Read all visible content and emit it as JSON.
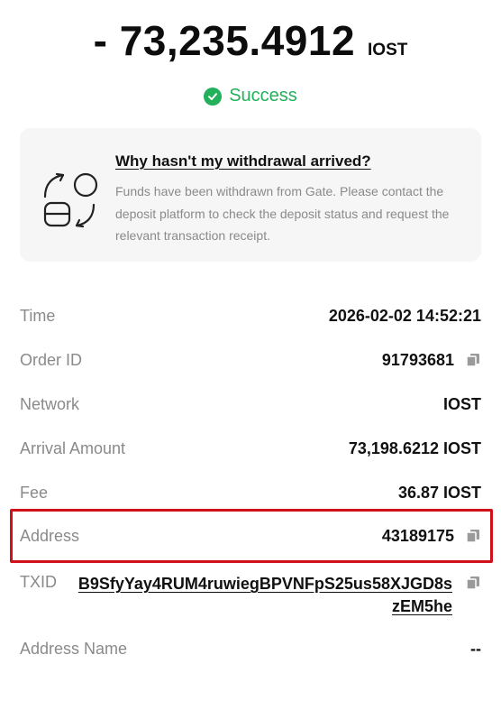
{
  "header": {
    "amount": "- 73,235.4912",
    "currency": "IOST",
    "status": "Success"
  },
  "info_card": {
    "title": "Why hasn't my withdrawal arrived?",
    "body": "Funds have been withdrawn from Gate. Please contact the deposit platform to check the deposit status and request the relevant transaction receipt."
  },
  "details": {
    "time_label": "Time",
    "time_value": "2026-02-02 14:52:21",
    "order_label": "Order ID",
    "order_value": "91793681",
    "network_label": "Network",
    "network_value": "IOST",
    "arrival_label": "Arrival Amount",
    "arrival_value": "73,198.6212 IOST",
    "fee_label": "Fee",
    "fee_value": "36.87 IOST",
    "address_label": "Address",
    "address_value": "43189175",
    "txid_label": "TXID",
    "txid_value": "B9SfyYay4RUM4ruwiegBPVNFpS25us58XJGD8szEM5he",
    "address_name_label": "Address Name",
    "address_name_value": "--"
  },
  "colors": {
    "success": "#22b15a",
    "highlight": "#d0111b",
    "label_gray": "#8a8a8a",
    "card_bg": "#f6f6f7"
  },
  "icons": {
    "status": "check-circle-icon",
    "copy": "copy-icon",
    "card": "transfer-graphic-icon"
  }
}
